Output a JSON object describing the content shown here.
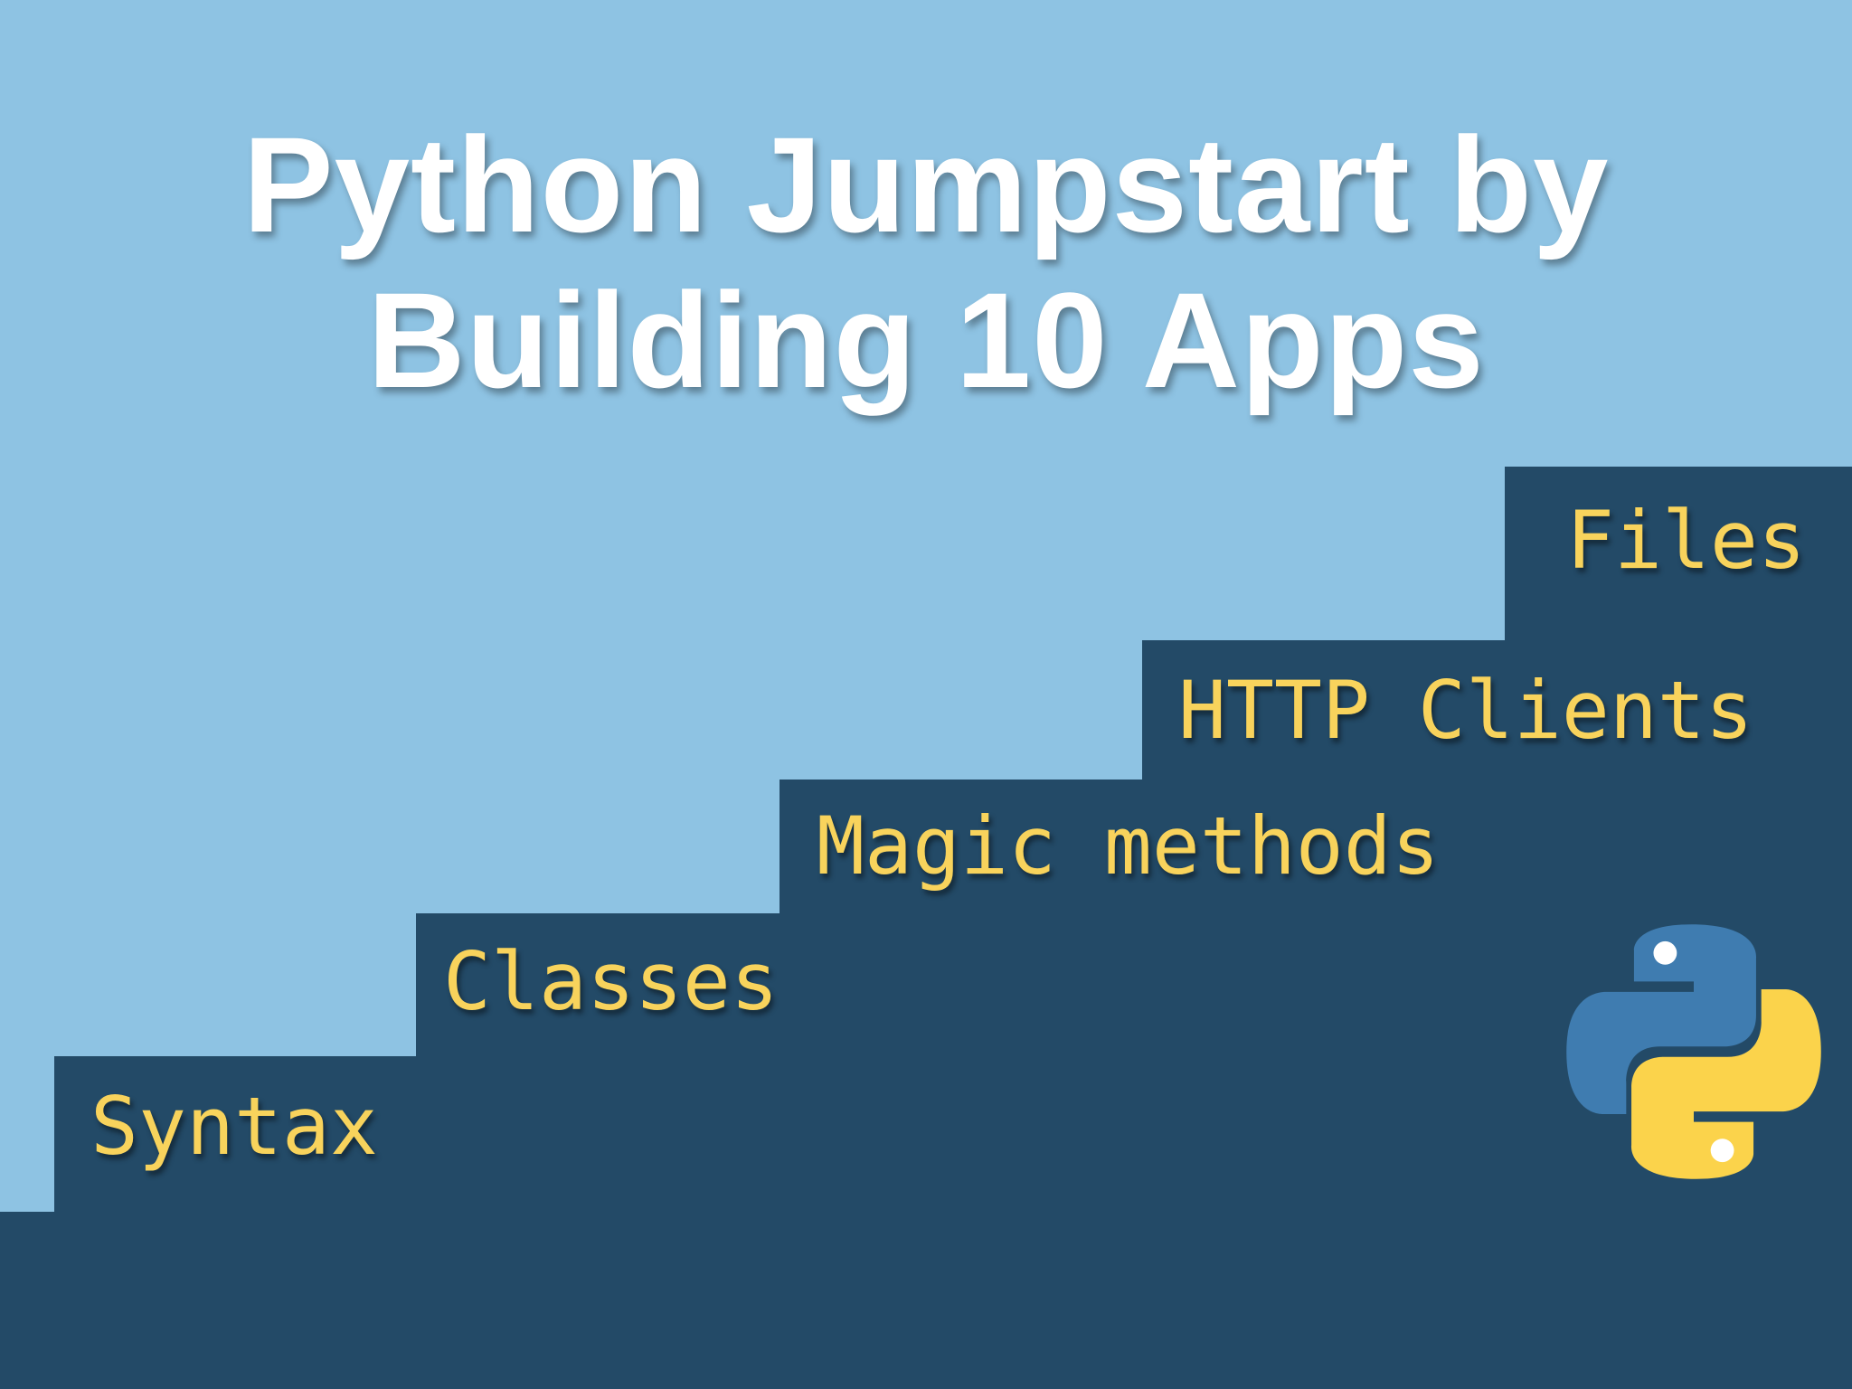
{
  "title": {
    "line1": "Python Jumpstart by",
    "line2": "Building 10 Apps"
  },
  "steps": [
    {
      "label": "Syntax"
    },
    {
      "label": "Classes"
    },
    {
      "label": "Magic methods"
    },
    {
      "label": "HTTP Clients"
    },
    {
      "label": "Files"
    }
  ],
  "colors": {
    "sky": "#8ec3e3",
    "stairs": "#234a67",
    "label": "#f8d35c",
    "title": "#ffffff",
    "logo_blue": "#3f7cb0",
    "logo_yellow": "#fbd34b"
  },
  "logo": {
    "icon": "python-logo-icon"
  }
}
